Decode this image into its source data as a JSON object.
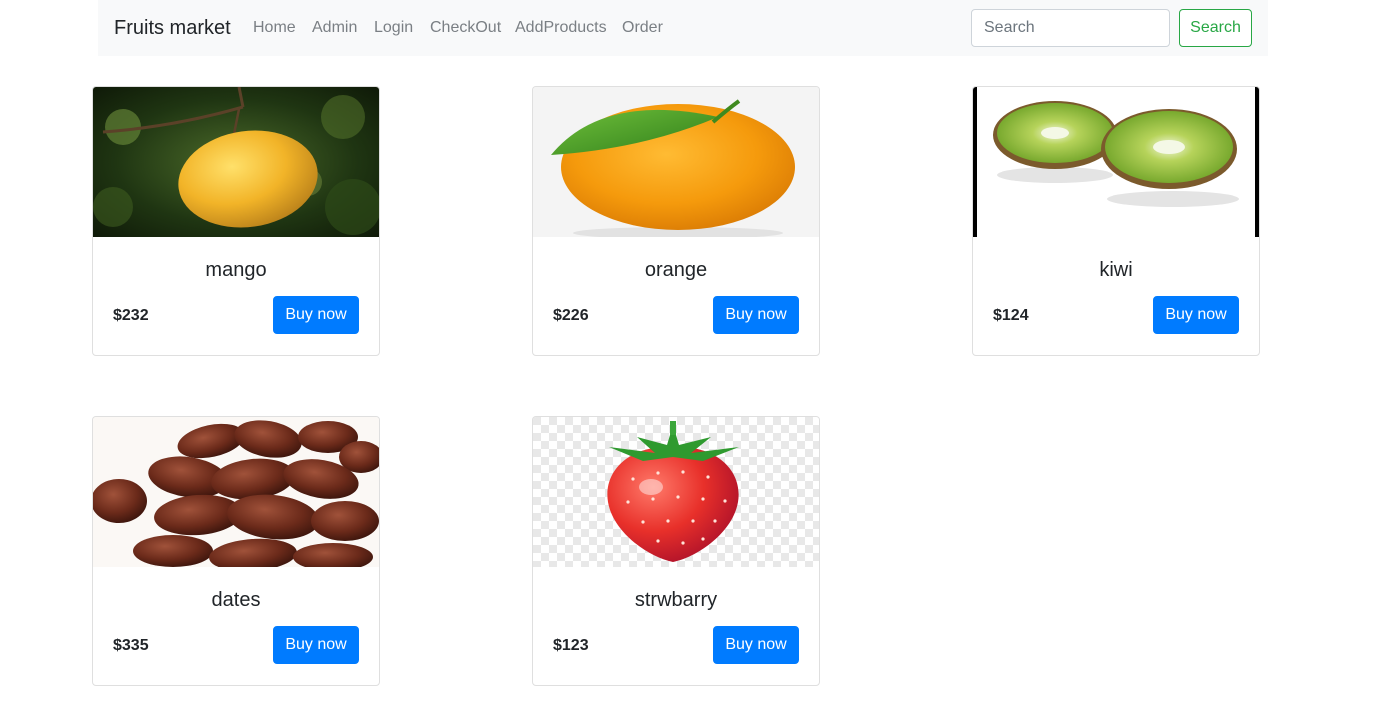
{
  "navbar": {
    "brand": "Fruits market",
    "links": [
      "Home",
      "Admin",
      "Login",
      "CheckOut",
      "AddProducts",
      "Order"
    ],
    "search": {
      "placeholder": "Search",
      "value": "",
      "button_label": "Search"
    }
  },
  "products": [
    {
      "name": "mango",
      "price": "$232",
      "button_label": "Buy now"
    },
    {
      "name": "orange",
      "price": "$226",
      "button_label": "Buy now"
    },
    {
      "name": "kiwi",
      "price": "$124",
      "button_label": "Buy now"
    },
    {
      "name": "dates",
      "price": "$335",
      "button_label": "Buy now"
    },
    {
      "name": "strwbarry",
      "price": "$123",
      "button_label": "Buy now"
    }
  ],
  "colors": {
    "primary": "#007bff",
    "success": "#28a745",
    "navbar_bg": "#f8f9fa",
    "nav_link": "#7a7f84"
  }
}
